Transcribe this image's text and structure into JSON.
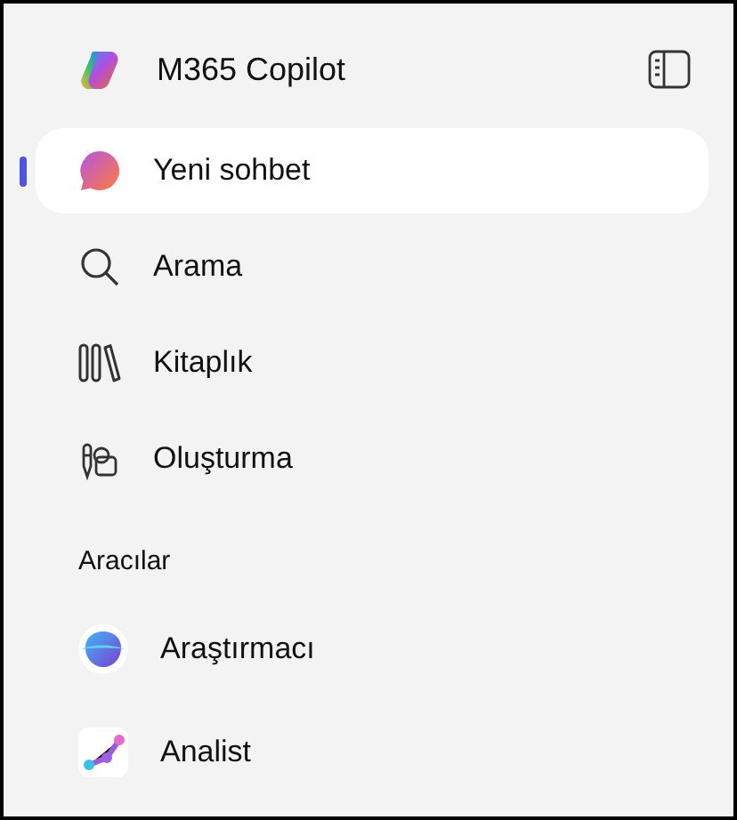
{
  "header": {
    "title": "M365 Copilot"
  },
  "nav": [
    {
      "kind": "chat",
      "label": "Yeni sohbet",
      "selected": true
    },
    {
      "kind": "search",
      "label": "Arama",
      "selected": false
    },
    {
      "kind": "library",
      "label": "Kitaplık",
      "selected": false
    },
    {
      "kind": "create",
      "label": "Oluşturma",
      "selected": false
    }
  ],
  "tools": {
    "heading": "Aracılar",
    "items": [
      {
        "kind": "researcher",
        "label": "Araştırmacı"
      },
      {
        "kind": "analyst",
        "label": "Analist"
      }
    ]
  }
}
